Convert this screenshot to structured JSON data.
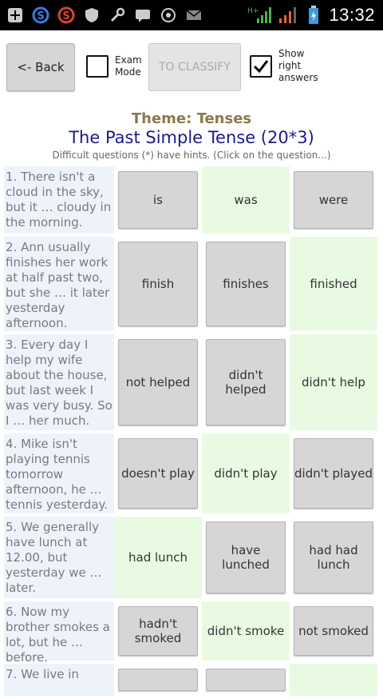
{
  "status_bar": {
    "time": "13:32",
    "network": "H+",
    "icons_left": [
      "add-icon",
      "s-app-icon",
      "s-app-red-icon",
      "shield-icon",
      "wrench-icon",
      "chat-icon",
      "whatsapp-icon",
      "mail-icon"
    ],
    "icons_right": [
      "signal-icon",
      "signal-icon-2",
      "battery-icon"
    ]
  },
  "toolbar": {
    "back_label": "<- Back",
    "exam_mode_label_1": "Exam",
    "exam_mode_label_2": "Mode",
    "classify_label": "TO CLASSIFY",
    "show_answers_label_1": "Show",
    "show_answers_label_2": "right",
    "show_answers_label_3": "answers",
    "exam_mode_checked": false,
    "show_answers_checked": true
  },
  "header": {
    "theme": "Theme: Tenses",
    "title": "The Past Simple Tense (20*3)",
    "hint": "Difficult questions (*) have hints. (Click on the question...)"
  },
  "questions": [
    {
      "text": "1. There isn't a cloud in the sky, but it … cloudy in the morning.",
      "answers": [
        "is",
        "was",
        "were"
      ],
      "correct": 1
    },
    {
      "text": "2. Ann usually finishes her work at half past two, but she … it later yesterday afternoon.",
      "answers": [
        "finish",
        "finishes",
        "finished"
      ],
      "correct": 2
    },
    {
      "text": "3. Every day I help my wife about the house, but last week I was very busy. So I … her much.",
      "answers": [
        "not helped",
        "didn't helped",
        "didn't help"
      ],
      "correct": 2
    },
    {
      "text": "4. Mike isn't playing tennis tomorrow afternoon, he … tennis yesterday.",
      "answers": [
        "doesn't play",
        "didn't play",
        "didn't played"
      ],
      "correct": 1
    },
    {
      "text": "5. We generally have lunch at 12.00, but yesterday we … later.",
      "answers": [
        "had lunch",
        "have lunched",
        "had had lunch"
      ],
      "correct": 0
    },
    {
      "text": "6. Now my brother smokes a lot, but he … before.",
      "answers": [
        "hadn't smoked",
        "didn't smoke",
        "not smoked"
      ],
      "correct": 1
    },
    {
      "text": "7. We live in",
      "answers": [
        "",
        "",
        ""
      ],
      "correct": 2
    }
  ],
  "colors": {
    "theme": "#8a7a4a",
    "title": "#1a1a8c",
    "correct_bg": "#e8fbe2",
    "question_bg": "#eef3fb"
  }
}
